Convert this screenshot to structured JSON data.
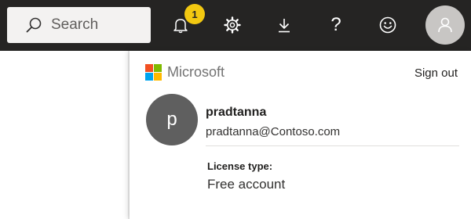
{
  "header": {
    "search": {
      "placeholder": "Search",
      "value": ""
    },
    "notifications": {
      "badge_count": "1",
      "badge_color": "#f2c811"
    },
    "icons": [
      "bell-icon",
      "gear-icon",
      "download-icon",
      "help-icon",
      "smiley-icon",
      "user-avatar-icon"
    ],
    "help_glyph": "?"
  },
  "account_panel": {
    "brand": {
      "name": "Microsoft",
      "logo_colors": [
        "#f25022",
        "#7fba00",
        "#00a4ef",
        "#ffb900"
      ]
    },
    "sign_out_label": "Sign out",
    "user": {
      "initial": "p",
      "name": "pradtanna",
      "email": "pradtanna@Contoso.com"
    },
    "license": {
      "label": "License type:",
      "value": "Free account"
    }
  },
  "colors": {
    "topbar": "#252423",
    "avatar_bg": "#c8c6c4",
    "profile_avatar_bg": "#5f5f5f"
  }
}
